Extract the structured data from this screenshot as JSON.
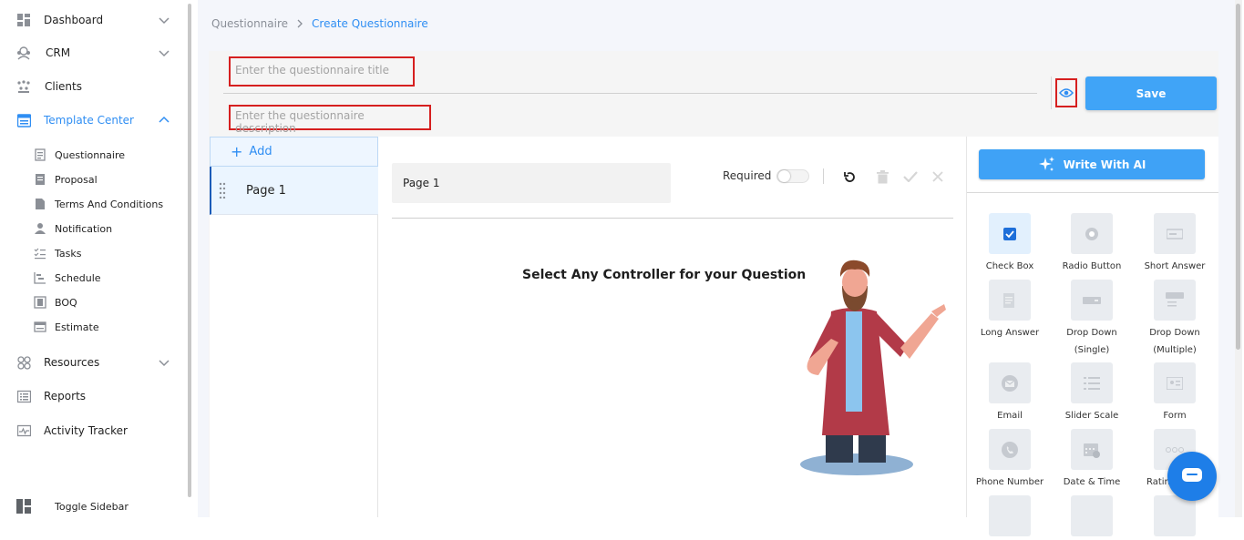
{
  "sidebar": {
    "items": [
      {
        "label": "Dashboard",
        "icon": "dashboard-icon"
      },
      {
        "label": "CRM",
        "icon": "crm-icon"
      },
      {
        "label": "Clients",
        "icon": "clients-icon"
      },
      {
        "label": "Template Center",
        "icon": "template-center-icon"
      },
      {
        "label": "Resources",
        "icon": "resources-icon"
      },
      {
        "label": "Reports",
        "icon": "reports-icon"
      },
      {
        "label": "Activity Tracker",
        "icon": "activity-tracker-icon"
      }
    ],
    "sub_items": [
      {
        "label": "Questionnaire",
        "icon": "questionnaire-icon"
      },
      {
        "label": "Proposal",
        "icon": "proposal-icon"
      },
      {
        "label": "Terms And Conditions",
        "icon": "document-icon"
      },
      {
        "label": "Notification",
        "icon": "user-icon"
      },
      {
        "label": "Tasks",
        "icon": "tasks-icon"
      },
      {
        "label": "Schedule",
        "icon": "schedule-icon"
      },
      {
        "label": "BOQ",
        "icon": "boq-icon"
      },
      {
        "label": "Estimate",
        "icon": "estimate-icon"
      }
    ],
    "toggle_label": "Toggle Sidebar",
    "active_color": "#2f8ef3"
  },
  "breadcrumb": {
    "parent": "Questionnaire",
    "current": "Create Questionnaire"
  },
  "form": {
    "title_placeholder": "Enter the questionnaire title",
    "description_placeholder": "Enter the questionnaire description",
    "save_label": "Save"
  },
  "pages": {
    "add_label": "Add",
    "items": [
      "Page 1"
    ]
  },
  "editor": {
    "page_name": "Page 1",
    "required_label": "Required",
    "required_on": false,
    "prompt": "Select Any Controller for your Question"
  },
  "controls": {
    "ai_label": "Write With AI",
    "items": [
      {
        "label": "Check Box",
        "icon": "checkbox-icon"
      },
      {
        "label": "Radio Button",
        "icon": "radio-icon"
      },
      {
        "label": "Short Answer",
        "icon": "short-answer-icon"
      },
      {
        "label": "Long Answer",
        "icon": "long-answer-icon"
      },
      {
        "label": "Drop Down",
        "label2": "(Single)",
        "icon": "dropdown-icon"
      },
      {
        "label": "Drop Down",
        "label2": "(Multiple)",
        "icon": "dropdown-multi-icon"
      },
      {
        "label": "Email",
        "icon": "email-icon"
      },
      {
        "label": "Slider Scale",
        "icon": "slider-icon"
      },
      {
        "label": "Form",
        "icon": "form-icon"
      },
      {
        "label": "Phone Number",
        "icon": "phone-icon"
      },
      {
        "label": "Date & Time",
        "icon": "calendar-icon"
      },
      {
        "label": "Ratin",
        "icon": "rating-icon"
      }
    ]
  },
  "colors": {
    "accent": "#2f8ef3",
    "save": "#40a4f7",
    "highlight_border": "#d61f1f"
  }
}
